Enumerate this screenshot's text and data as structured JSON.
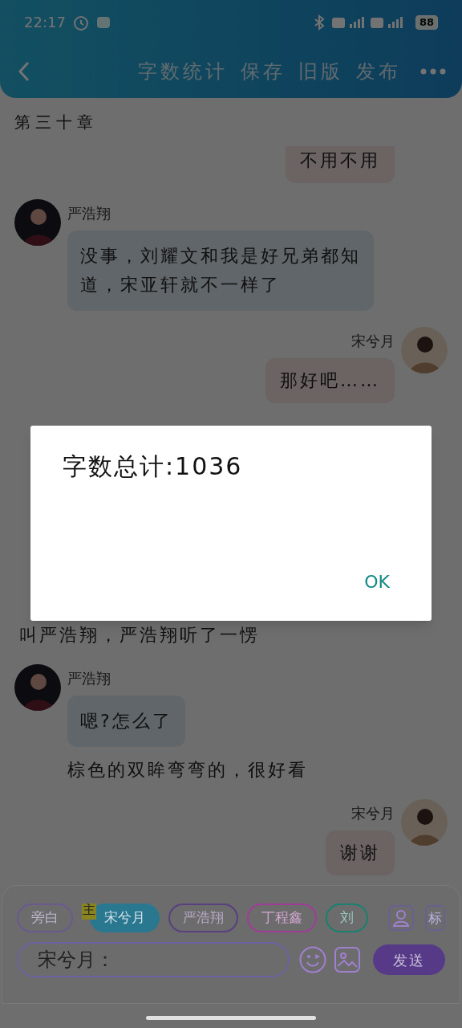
{
  "status_bar": {
    "time": "22:17",
    "battery": "88"
  },
  "toolbar": {
    "items": [
      "字数统计",
      "保存",
      "旧版",
      "发布"
    ]
  },
  "chapter": "第三十章",
  "messages": [
    {
      "kind": "right",
      "text": "不用不用"
    },
    {
      "kind": "left",
      "name": "严浩翔",
      "text": "没事，刘耀文和我是好兄弟都知道，宋亚轩就不一样了"
    },
    {
      "kind": "right",
      "name": "宋兮月",
      "text": "那好吧……"
    },
    {
      "kind": "narration",
      "text": "叫严浩翔，严浩翔听了一愣"
    },
    {
      "kind": "left",
      "name": "严浩翔",
      "text": "嗯?怎么了"
    },
    {
      "kind": "aside",
      "text": "棕色的双眸弯弯的，很好看"
    },
    {
      "kind": "right",
      "name": "宋兮月",
      "text": "谢谢"
    }
  ],
  "composer": {
    "roles": [
      {
        "label": "旁白",
        "color": "#6a5a90",
        "selected": false
      },
      {
        "label": "宋兮月",
        "color": "#2a7890",
        "selected": true,
        "badge": "主"
      },
      {
        "label": "严浩翔",
        "color": "#5a3f80",
        "selected": false
      },
      {
        "label": "丁程鑫",
        "color": "#a03c98",
        "selected": false
      },
      {
        "label": "刘",
        "color": "#1a8070",
        "selected": false
      }
    ],
    "tag_button": "标",
    "input_value": "宋兮月：",
    "send": "发送"
  },
  "dialog": {
    "message": "字数总计:1036",
    "button": "OK"
  }
}
